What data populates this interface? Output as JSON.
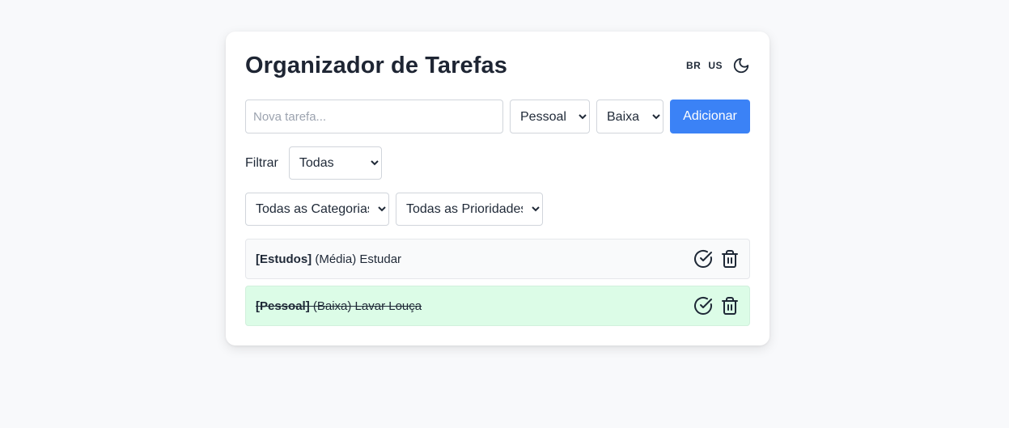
{
  "header": {
    "title": "Organizador de Tarefas",
    "lang_br": "BR",
    "lang_us": "US",
    "theme_icon": "moon-icon"
  },
  "add_form": {
    "input_value": "",
    "input_placeholder": "Nova tarefa...",
    "category_selected": "Pessoal",
    "priority_selected": "Baixa",
    "add_label": "Adicionar"
  },
  "filter": {
    "label": "Filtrar",
    "status_selected": "Todas",
    "category_selected": "Todas as Categorias",
    "priority_selected": "Todas as Prioridades"
  },
  "tasks": [
    {
      "category": "[Estudos]",
      "rest": " (Média) Estudar",
      "completed": false
    },
    {
      "category": "[Pessoal]",
      "rest": " (Baixa) Lavar Louça",
      "completed": true
    }
  ],
  "colors": {
    "accent": "#3b82f6",
    "completed_bg": "#dcfce7",
    "text": "#1f2937"
  },
  "icons": {
    "complete": "check-circle-icon",
    "delete": "trash-icon"
  }
}
